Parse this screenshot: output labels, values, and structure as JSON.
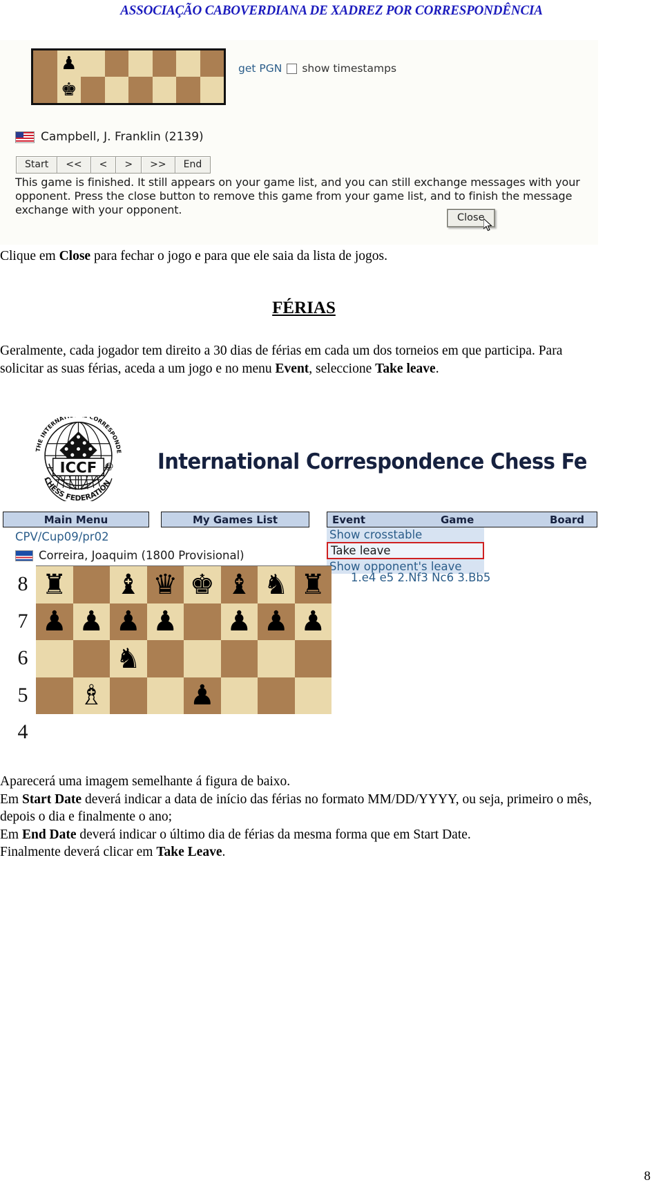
{
  "header": {
    "title": "ASSOCIAÇÃO CABOVERDIANA DE XADREZ POR CORRESPONDÊNCIA"
  },
  "screenshot_finished_game": {
    "get_pgn_label": "get PGN",
    "show_timestamps_label": "show timestamps",
    "player": "Campbell, J. Franklin (2139)",
    "player_flag": "us-flag-icon",
    "nav_buttons": [
      "Start",
      "<<",
      "<",
      ">",
      ">>",
      "End"
    ],
    "message": "This game is finished. It still appears on your game list, and you can still exchange messages with your opponent. Press the close button to remove this game from your game list, and to finish the message exchange with your opponent.",
    "close_button": "Close",
    "cursor_icon": "mouse-pointer-icon",
    "board_pieces": [
      "black-pawn",
      "black-king"
    ],
    "board_light_color": "#ead9ab",
    "board_dark_color": "#ab7f52"
  },
  "body": {
    "p1": "Clique em ",
    "p1_bold": "Close",
    "p1_rest": " para fechar o jogo e para que ele saia da lista de jogos.",
    "section_title": "FÉRIAS",
    "p2_a": "Geralmente, cada jogador tem direito a 30 dias de férias em cada um dos torneios em que participa. Para solicitar as suas férias, aceda a um jogo e no menu ",
    "p2_b": "Event",
    "p2_c": ", seleccione ",
    "p2_d": "Take leave",
    "p2_e": ".",
    "p3_line1": "Aparecerá uma imagem semelhante á figura de baixo.",
    "p3_line2_a": "Em ",
    "p3_line2_b": "Start Date",
    "p3_line2_c": " deverá indicar a data de início das férias no formato MM/DD/YYYY, ou seja, primeiro o mês, depois o dia e finalmente o ano;",
    "p3_line3_a": "Em ",
    "p3_line3_b": "End Date",
    "p3_line3_c": " deverá indicar o último dia de férias da mesma forma que em Start Date.",
    "p3_line4_a": "Finalmente deverá clicar em ",
    "p3_line4_b": "Take Leave",
    "p3_line4_c": "."
  },
  "screenshot_take_leave": {
    "logo_alt": "iccf-logo-icon",
    "logo_text_top": "THE INTERNATIONAL CORRESPONDENCE",
    "logo_text_center": "ICCF",
    "logo_text_at": "@",
    "logo_text_bottom": "CHESS FEDERATION",
    "site_title": "International Correspondence Chess Fe",
    "menu_buttons": [
      "Main Menu",
      "My Games List"
    ],
    "menu_columns": [
      "Event",
      "Game",
      "Board"
    ],
    "event_code": "CPV/Cup09/pr02",
    "player": "Correira, Joaquim (1800 Provisional)",
    "player_flag": "cape-verde-flag-icon",
    "dropdown_items": [
      "Show crosstable",
      "Take leave",
      "Show opponent's leave"
    ],
    "dropdown_selected": "Take leave",
    "moves": "1.e4 e5 2.Nf3 Nc6 3.Bb5",
    "rank_labels": [
      "8",
      "7",
      "6",
      "5",
      "4"
    ],
    "highlight_color": "#cf2020",
    "menu_bg_color": "#c4d3e8"
  },
  "footer": {
    "page_number": "8"
  }
}
